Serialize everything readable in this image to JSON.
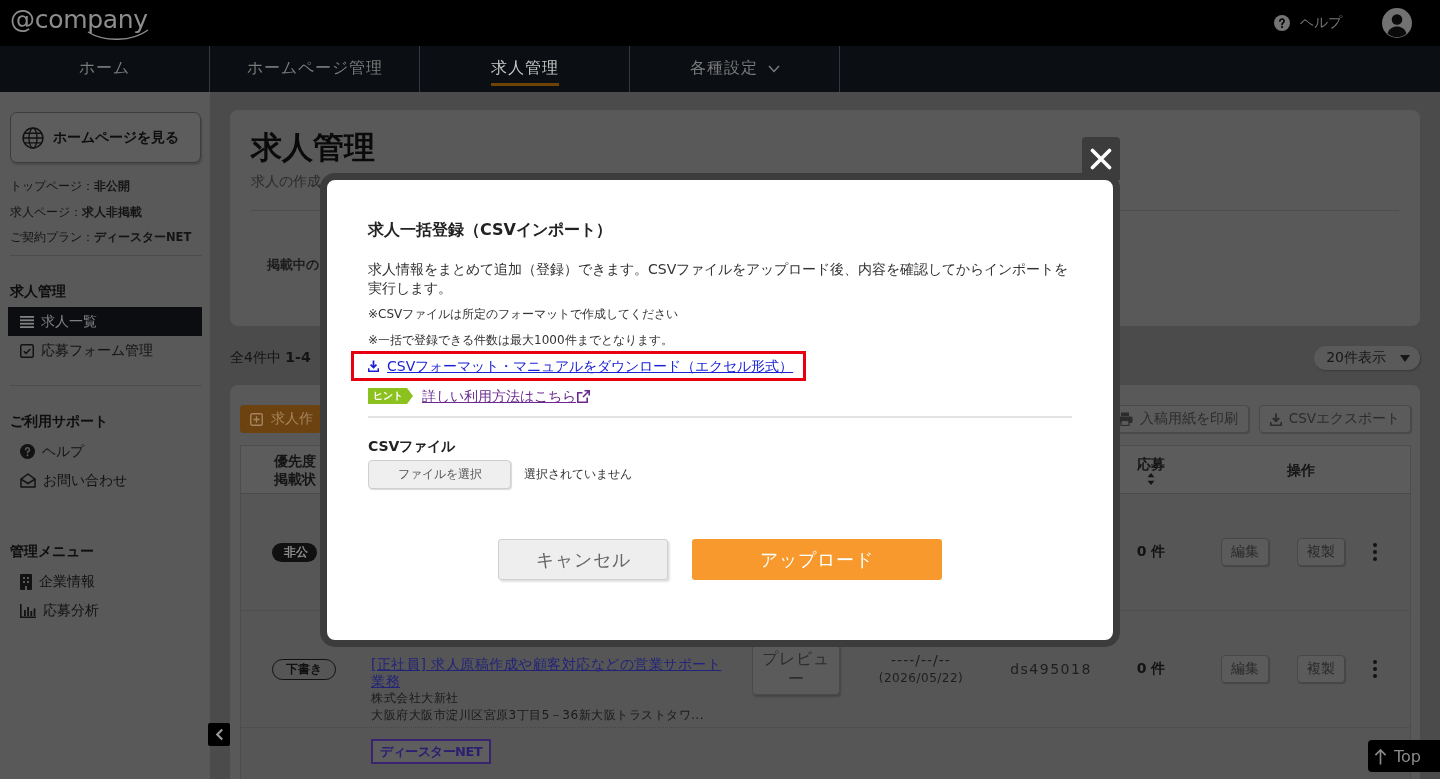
{
  "header": {
    "logo": "@company",
    "help_link": "ヘルプ"
  },
  "nav": [
    {
      "label": "ホーム",
      "selected": false,
      "menu": false
    },
    {
      "label": "ホームページ管理",
      "selected": false,
      "menu": false
    },
    {
      "label": "求人管理",
      "selected": true,
      "menu": false
    },
    {
      "label": "各種設定",
      "selected": false,
      "menu": true
    }
  ],
  "sidebar": {
    "site_button": "ホームページを見る",
    "status": [
      {
        "label": "トップページ：",
        "value": "非公開"
      },
      {
        "label": "求人ページ：",
        "value": "求人非掲載"
      },
      {
        "label": "ご契約プラン：",
        "value": "ディースターNET"
      }
    ],
    "sections": [
      {
        "heading": "求人管理",
        "items": [
          {
            "label": "求人一覧",
            "selected": true
          },
          {
            "label": "応募フォーム管理",
            "selected": false
          }
        ]
      },
      {
        "heading": "ご利用サポート",
        "items": [
          {
            "label": "ヘルプ",
            "selected": false
          },
          {
            "label": "お問い合わせ",
            "selected": false
          }
        ]
      },
      {
        "heading": "管理メニュー",
        "items": [
          {
            "label": "企業情報",
            "selected": false
          },
          {
            "label": "応募分析",
            "selected": false
          }
        ]
      }
    ]
  },
  "page_header": {
    "title": "求人管理",
    "subtitle": "求人の作成",
    "stat_label": "掲載中の"
  },
  "listing": {
    "count_text": "全4件中 **1-4**",
    "per_page": "20件表示",
    "create_button": "求人作",
    "toolbar_buttons": [
      "入稿用紙を印刷",
      "CSVエクスポート"
    ],
    "columns": [
      {
        "lines": [
          "優先度",
          "掲載状"
        ],
        "sortable": false
      },
      {
        "lines": [
          "応募"
        ],
        "sortable": true
      },
      {
        "lines": [
          "操作"
        ],
        "sortable": false
      }
    ],
    "rows": [
      {
        "status": {
          "text": "非公",
          "kind": "private"
        },
        "applications": "0 件",
        "actions": [
          "編集",
          "複製"
        ]
      },
      {
        "status": {
          "text": "下書き",
          "kind": "draft"
        },
        "title": "[正社員] 求人原稿作成や顧客対応などの営業サポート業務",
        "company": "株式会社大新社",
        "address": "大阪府大阪市淀川区宮原3丁目5－36新大阪トラストタワ...",
        "preview_button": "プレビュー",
        "date": "----/--/--",
        "date_sub": "(2026/05/22)",
        "code": "ds495018",
        "applications": "0 件",
        "actions": [
          "編集",
          "複製"
        ]
      },
      {
        "logo": "ディースターNET"
      }
    ]
  },
  "top_button": "Top",
  "modal": {
    "title": "求人一括登録（CSVインポート）",
    "description": "求人情報をまとめて追加（登録）できます。CSVファイルをアップロード後、内容を確認してからインポートを実行します。",
    "notes": [
      "※CSVファイルは所定のフォーマットで作成してください",
      "※一括で登録できる件数は最大1000件までとなります。"
    ],
    "download_link": {
      "label": "CSVフォーマット・マニュアルをダウンロード（エクセル形式）",
      "highlighted": true
    },
    "hint": {
      "badge": "ヒント",
      "link": "詳しい利用方法はこちら",
      "visited": true
    },
    "file_field": {
      "label": "CSVファイル",
      "button": "ファイルを選択",
      "status": "選択されていません"
    },
    "buttons": [
      {
        "label": "キャンセル",
        "kind": "secondary"
      },
      {
        "label": "アップロード",
        "kind": "primary"
      }
    ]
  }
}
